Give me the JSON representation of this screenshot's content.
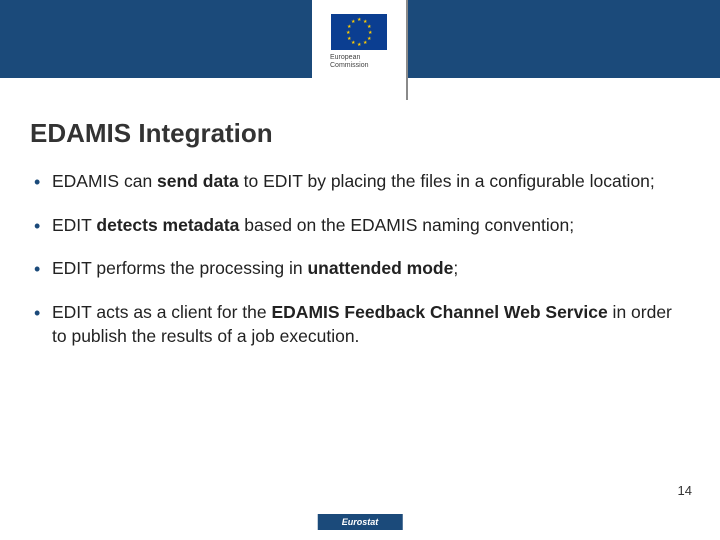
{
  "logo": {
    "alt": "European Commission",
    "line1": "European",
    "line2": "Commission"
  },
  "title": "EDAMIS Integration",
  "bullets": [
    {
      "segments": [
        {
          "t": "EDAMIS can ",
          "b": false
        },
        {
          "t": "send data",
          "b": true
        },
        {
          "t": " to EDIT by placing the files in a configurable location;",
          "b": false
        }
      ]
    },
    {
      "segments": [
        {
          "t": "EDIT ",
          "b": false
        },
        {
          "t": "detects metadata",
          "b": true
        },
        {
          "t": " based on the EDAMIS naming convention;",
          "b": false
        }
      ]
    },
    {
      "segments": [
        {
          "t": "EDIT performs the processing in ",
          "b": false
        },
        {
          "t": "unattended mode",
          "b": true
        },
        {
          "t": ";",
          "b": false
        }
      ]
    },
    {
      "segments": [
        {
          "t": "EDIT acts as a client for the ",
          "b": false
        },
        {
          "t": "EDAMIS Feedback Channel Web Service",
          "b": true
        },
        {
          "t": " in order to publish the results of a job execution.",
          "b": false
        }
      ]
    }
  ],
  "page_number": "14",
  "footer": "Eurostat"
}
